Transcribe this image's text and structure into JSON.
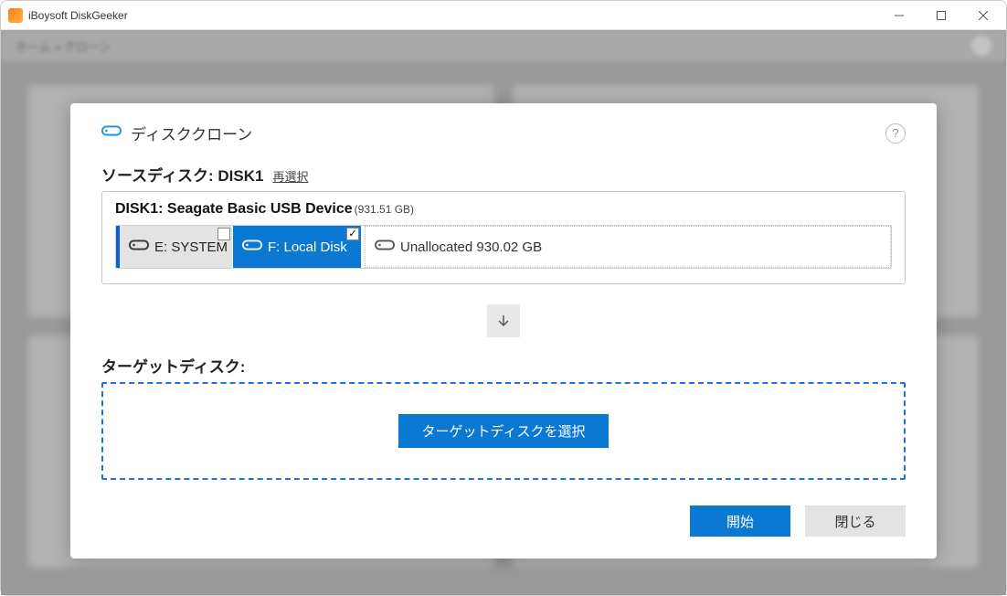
{
  "window": {
    "title": "iBoysoft DiskGeeker"
  },
  "breadcrumb": "ホーム  »  クローン",
  "modal": {
    "title": "ディスククローン",
    "help_tooltip": "?",
    "source": {
      "label_prefix": "ソースディスク:",
      "label_disk": "DISK1",
      "reselect": "再選択",
      "disk_title": "DISK1: Seagate Basic USB Device",
      "disk_size": "(931.51 GB)",
      "partitions": [
        {
          "id": "e",
          "label": "E: SYSTEM",
          "selected": false,
          "checkbox": true
        },
        {
          "id": "f",
          "label": "F: Local Disk",
          "selected": true,
          "checkbox": true
        },
        {
          "id": "un",
          "label": "Unallocated 930.02 GB",
          "selected": false,
          "checkbox": false
        }
      ]
    },
    "target": {
      "label": "ターゲットディスク:",
      "select_button": "ターゲットディスクを選択"
    },
    "footer": {
      "start": "開始",
      "close": "閉じる"
    }
  }
}
